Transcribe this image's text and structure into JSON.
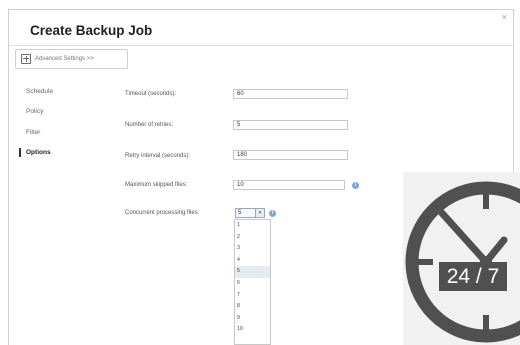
{
  "dialog": {
    "title": "Create Backup Job",
    "close_icon": "close-icon"
  },
  "toolbar": {
    "advanced_settings_label": "Advanced Settings >>",
    "advanced_icon": "plus-box-icon"
  },
  "sidebar": {
    "items": [
      {
        "label": "Schedule",
        "active": false
      },
      {
        "label": "Policy",
        "active": false
      },
      {
        "label": "Filter",
        "active": false
      },
      {
        "label": "Options",
        "active": true
      }
    ]
  },
  "form": {
    "rows": [
      {
        "label": "Timeout (seconds):",
        "value": "60"
      },
      {
        "label": "Number of retries:",
        "value": "5"
      },
      {
        "label": "Retry interval (seconds):",
        "value": "180"
      },
      {
        "label": "Maximum skipped files:",
        "value": "10"
      },
      {
        "label": "Concurrent processing files:",
        "value": "5"
      }
    ],
    "concurrent_options": [
      "1",
      "2",
      "3",
      "4",
      "5",
      "6",
      "7",
      "8",
      "9",
      "10"
    ],
    "highlighted_option": "5"
  },
  "overlay": {
    "badge_text": "24 / 7",
    "icon": "clock-icon",
    "color": "#505050"
  }
}
